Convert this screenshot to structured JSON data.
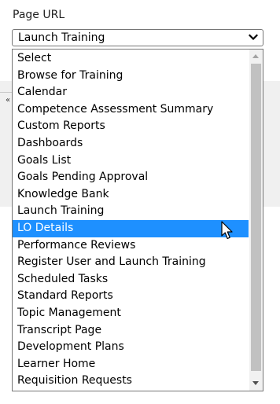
{
  "field": {
    "label": "Page URL",
    "selected_value": "Launch Training"
  },
  "dropdown": {
    "highlighted_option": "LO Details",
    "options": [
      "Select",
      "Browse for Training",
      "Calendar",
      "Competence Assessment Summary",
      "Custom Reports",
      "Dashboards",
      "Goals List",
      "Goals Pending Approval",
      "Knowledge Bank",
      "Launch Training",
      "LO Details",
      "Performance Reviews",
      "Register User and Launch Training",
      "Scheduled Tasks",
      "Standard Reports",
      "Topic Management",
      "Transcript Page",
      "Development Plans",
      "Learner Home",
      "Requisition Requests"
    ]
  },
  "background": {
    "partial_glyph": "«"
  },
  "colors": {
    "highlight": "#1e90ff",
    "highlight_text": "#ffffff",
    "border": "#767676",
    "scroll_thumb": "#c1c1c1"
  },
  "icons": {
    "select_chevron": "chevron-down-icon",
    "scroll_up": "scroll-up-arrow-icon",
    "scroll_down": "scroll-down-arrow-icon",
    "cursor": "mouse-pointer-icon"
  }
}
